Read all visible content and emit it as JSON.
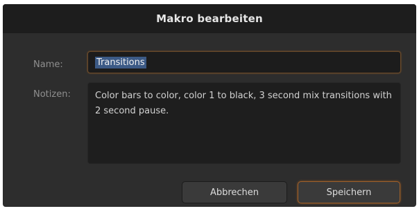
{
  "dialog": {
    "title": "Makro bearbeiten",
    "name_label": "Name:",
    "name_value": "Transitions",
    "notes_label": "Notizen:",
    "notes_value": "Color bars to color, color 1 to black, 3 second mix transitions with 2 second pause.",
    "cancel_label": "Abbrechen",
    "save_label": "Speichern"
  },
  "colors": {
    "dialog_background": "#2d2d2d",
    "titlebar_background": "#1d1d1d",
    "focus_accent": "#a0602a",
    "selection_highlight": "#3c5a86"
  }
}
